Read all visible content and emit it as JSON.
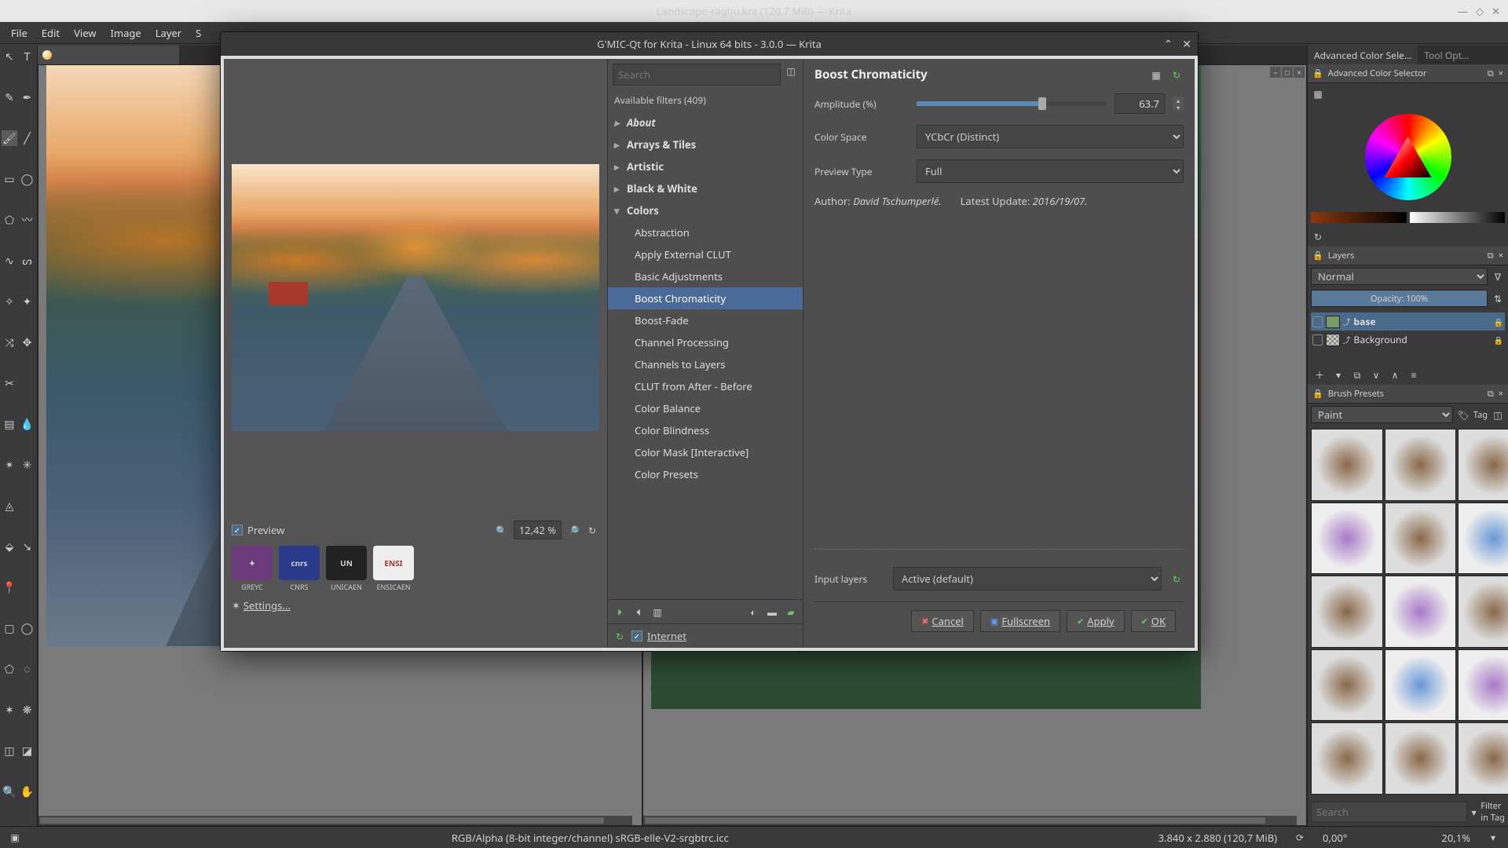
{
  "window": {
    "title": "Landscape-raghu.kra (120,7 MiB) — Krita"
  },
  "menubar": [
    "File",
    "Edit",
    "View",
    "Image",
    "Layer",
    "S"
  ],
  "statusbar": {
    "color_profile": "RGB/Alpha (8-bit integer/channel)  sRGB-elle-V2-srgbtrc.icc",
    "dimensions": "3.840 x 2.880 (120,7 MiB)",
    "rotation": "0,00°",
    "zoom": "20,1%"
  },
  "right_panels": {
    "color_tab": "Advanced Color Sele…",
    "toolopt_tab": "Tool Opt…",
    "color_hdr": "Advanced Color Selector",
    "layers_hdr": "Layers",
    "blend_mode": "Normal",
    "opacity": "Opacity:  100%",
    "layers": [
      "base",
      "Background"
    ],
    "brush_hdr": "Brush Presets",
    "brush_tag": "Paint",
    "brush_tag_btn": "Tag",
    "brush_search": "Search",
    "brush_filter": "Filter in Tag"
  },
  "dialog": {
    "title": "G'MIC-Qt for Krita - Linux 64 bits - 3.0.0 — Krita",
    "search_placeholder": "Search",
    "filter_count": "Available filters (409)",
    "categories": [
      {
        "label": "About",
        "type": "italic"
      },
      {
        "label": "Arrays & Tiles",
        "type": "cat"
      },
      {
        "label": "Artistic",
        "type": "cat"
      },
      {
        "label": "Black & White",
        "type": "cat"
      },
      {
        "label": "Colors",
        "type": "cat open"
      }
    ],
    "color_subs": [
      "Abstraction",
      "Apply External CLUT",
      "Basic Adjustments",
      "Boost Chromaticity",
      "Boost-Fade",
      "Channel Processing",
      "Channels to Layers",
      "CLUT from After - Before",
      "Color Balance",
      "Color Blindness",
      "Color Mask [Interactive]",
      "Color Presets"
    ],
    "selected_sub": "Boost Chromaticity",
    "preview_label": "Preview",
    "preview_zoom": "12,42 %",
    "logos": [
      "GREYC",
      "CNRS",
      "UNICAEN",
      "ENSICAEN"
    ],
    "settings": "Settings...",
    "internet": "Internet",
    "filter_name": "Boost Chromaticity",
    "params": {
      "amplitude_label": "Amplitude (%)",
      "amplitude_value": "63.7",
      "colorspace_label": "Color Space",
      "colorspace_value": "YCbCr (Distinct)",
      "previewtype_label": "Preview Type",
      "previewtype_value": "Full"
    },
    "meta": {
      "author_label": "Author:",
      "author": "David Tschumperlé.",
      "update_label": "Latest Update:",
      "update": "2016/19/07."
    },
    "input_layers_label": "Input layers",
    "input_layers_value": "Active (default)",
    "buttons": {
      "cancel": "Cancel",
      "fullscreen": "Fullscreen",
      "apply": "Apply",
      "ok": "OK"
    }
  }
}
